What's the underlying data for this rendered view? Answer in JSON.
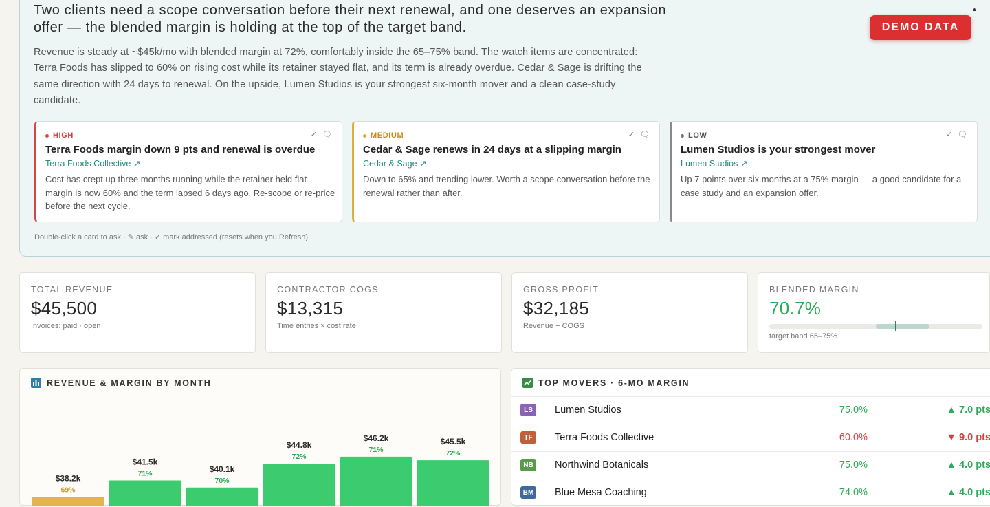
{
  "insights": {
    "headline": "Two clients need a scope conversation before their next renewal, and one deserves an expansion offer — the blended margin is holding at the top of the target band.",
    "demo_badge": "DEMO DATA",
    "summary": "Revenue is steady at ~$45k/mo with blended margin at 72%, comfortably inside the 65–75% band. The watch items are concentrated: Terra Foods has slipped to 60% on rising cost while its retainer stayed flat, and its term is already overdue. Cedar & Sage is drifting the same direction with 24 days to renewal. On the upside, Lumen Studios is your strongest six-month mover and a clean case-study candidate.",
    "cards": [
      {
        "severity": "HIGH",
        "title": "Terra Foods margin down 9 pts and renewal is overdue",
        "link": "Terra Foods Collective ↗",
        "body": "Cost has crept up three months running while the retainer held flat — margin is now 60% and the term lapsed 6 days ago. Re-scope or re-price before the next cycle."
      },
      {
        "severity": "MEDIUM",
        "title": "Cedar & Sage renews in 24 days at a slipping margin",
        "link": "Cedar & Sage ↗",
        "body": "Down to 65% and trending lower. Worth a scope conversation before the renewal rather than after."
      },
      {
        "severity": "LOW",
        "title": "Lumen Studios is your strongest mover",
        "link": "Lumen Studios ↗",
        "body": "Up 7 points over six months at a 75% margin — a good candidate for a case study and an expansion offer."
      }
    ],
    "hint": "Double-click a card to ask · ✎ ask · ✓ mark addressed (resets when you Refresh)."
  },
  "kpis": {
    "revenue": {
      "label": "TOTAL REVENUE",
      "value": "$45,500",
      "sub": "Invoices: paid · open"
    },
    "cogs": {
      "label": "CONTRACTOR COGS",
      "value": "$13,315",
      "sub": "Time entries × cost rate"
    },
    "profit": {
      "label": "GROSS PROFIT",
      "value": "$32,185",
      "sub": "Revenue − COGS"
    },
    "margin": {
      "label": "BLENDED MARGIN",
      "value": "70.7%",
      "sub": "target band 65–75%",
      "fraction": 0.707
    }
  },
  "chart": {
    "title": "REVENUE & MARGIN BY MONTH",
    "colors": {
      "below": "#e3b34f",
      "inband": "#3ccc6f"
    }
  },
  "chart_data": {
    "type": "bar",
    "title": "REVENUE & MARGIN BY MONTH",
    "values": [
      38.2,
      41.5,
      40.1,
      44.8,
      46.2,
      45.5
    ],
    "value_labels": [
      "$38.2k",
      "$41.5k",
      "$40.1k",
      "$44.8k",
      "$46.2k",
      "$45.5k"
    ],
    "margins": [
      69,
      71,
      70,
      72,
      71,
      72
    ],
    "margin_labels": [
      "69%",
      "71%",
      "70%",
      "72%",
      "71%",
      "72%"
    ],
    "bar_colors": [
      "#e3b34f",
      "#3ccc6f",
      "#3ccc6f",
      "#3ccc6f",
      "#3ccc6f",
      "#3ccc6f"
    ]
  },
  "movers": {
    "title": "TOP MOVERS · 6-MO MARGIN",
    "rows": [
      {
        "initials": "LS",
        "color": "#8a63b8",
        "name": "Lumen Studios",
        "margin": "75.0%",
        "delta": "▲ 7.0 pts",
        "dir": "up"
      },
      {
        "initials": "TF",
        "color": "#c0603a",
        "name": "Terra Foods Collective",
        "margin": "60.0%",
        "delta": "▼ 9.0 pts",
        "dir": "down"
      },
      {
        "initials": "NB",
        "color": "#5a9a4a",
        "name": "Northwind Botanicals",
        "margin": "75.0%",
        "delta": "▲ 4.0 pts",
        "dir": "up"
      },
      {
        "initials": "BM",
        "color": "#3f6a9a",
        "name": "Blue Mesa Coaching",
        "margin": "74.0%",
        "delta": "▲ 4.0 pts",
        "dir": "up"
      }
    ]
  }
}
